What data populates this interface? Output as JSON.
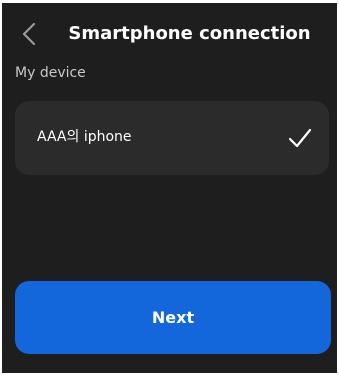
{
  "header": {
    "title": "Smartphone connection",
    "back_icon": "chevron-left-icon"
  },
  "section": {
    "label": "My device"
  },
  "device": {
    "name": "AAA의 iphone",
    "selected": true,
    "selected_icon": "checkmark-icon"
  },
  "footer": {
    "next_label": "Next"
  },
  "colors": {
    "background": "#1e1e1e",
    "card": "#2b2b2b",
    "accent": "#1467da",
    "text": "#ffffff",
    "muted_text": "#c8c8c8"
  }
}
